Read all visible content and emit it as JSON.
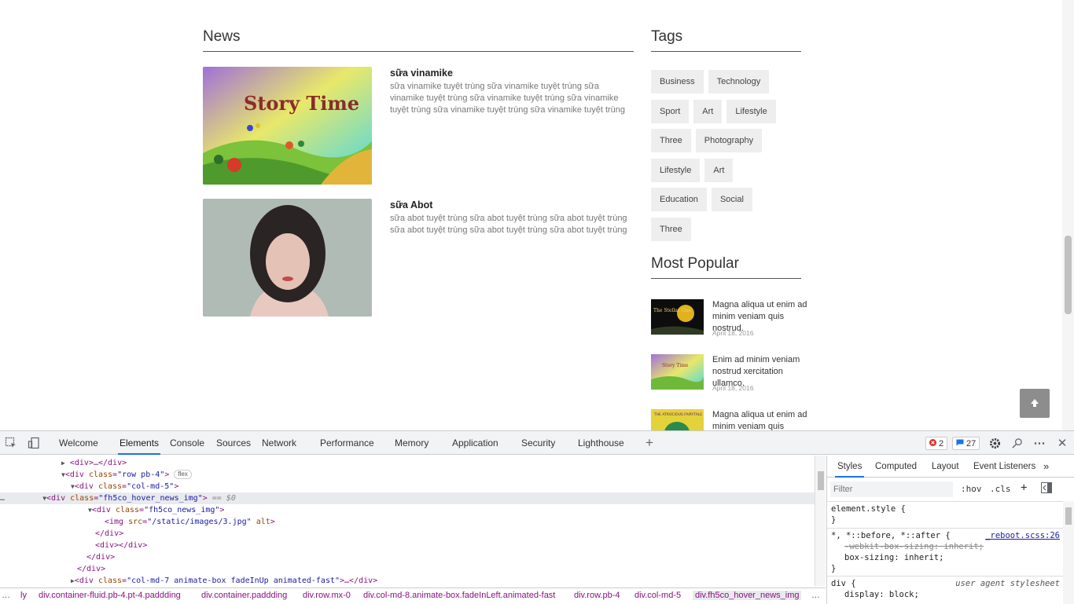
{
  "news": {
    "heading": "News",
    "items": [
      {
        "title": "sữa vinamike",
        "desc": "sữa vinamike tuyệt trùng sữa vinamike tuyệt trùng sữa vinamike tuyệt trùng sữa vinamike tuyệt trùng sữa vinamike tuyệt trùng sữa vinamike tuyệt trùng sữa vinamike tuyệt trùng",
        "image_text": "Story Time"
      },
      {
        "title": "sữa Abot",
        "desc": "sữa abot tuyệt trùng sữa abot tuyệt trùng sữa abot tuyệt trùng sữa abot tuyệt trùng sữa abot tuyệt trùng sữa abot tuyệt trùng"
      }
    ]
  },
  "tags": {
    "heading": "Tags",
    "items": [
      "Business",
      "Technology",
      "Sport",
      "Art",
      "Lifestyle",
      "Three",
      "Photography",
      "Lifestyle",
      "Art",
      "Education",
      "Social",
      "Three"
    ]
  },
  "popular": {
    "heading": "Most Popular",
    "items": [
      {
        "title": "Magna aliqua ut enim ad minim veniam quis nostrud.",
        "date": "April 18, 2016",
        "image_text": "The Stellar One"
      },
      {
        "title": "Enim ad minim veniam nostrud xercitation ullamco.",
        "date": "April 18, 2016",
        "image_text": "Story Time"
      },
      {
        "title": "Magna aliqua ut enim ad minim veniam quis",
        "date": "",
        "image_text": "THE ATROCIOUS FAIRYTALE"
      }
    ]
  },
  "back_to_top": {
    "icon": "arrow-up-icon"
  },
  "devtools": {
    "tabs": [
      "Welcome",
      "Elements",
      "Console",
      "Sources",
      "Network",
      "Performance",
      "Memory",
      "Application",
      "Security",
      "Lighthouse"
    ],
    "active_tab": "Elements",
    "error_count": "2",
    "message_count": "27",
    "dom": {
      "l1": "<div>…</div>",
      "l2_tag": "<div ",
      "l2_attr": "class",
      "l2_val": "\"row pb-4\"",
      "l2_pill": "flex",
      "l3_attr": "class",
      "l3_val": "\"col-md-5\"",
      "l4_attr": "class",
      "l4_val": "\"fh5co_hover_news_img\"",
      "l4_sel": "== $0",
      "l5_attr": "class",
      "l5_val": "\"fh5co_news_img\"",
      "l6_attr": "src",
      "l6_val": "\"/static/images/3.jpg\"",
      "l6_alt": "alt",
      "l7": "</div>",
      "l8": "<div></div>",
      "l9": "</div>",
      "l10": "</div>",
      "l11_attr": "class",
      "l11_val": "\"col-md-7 animate-box fadeInUp animated-fast\"",
      "l11_end": ">…</div>"
    },
    "breadcrumbs": [
      "ly",
      "div.container-fluid.pb-4.pt-4.paddding",
      "div.container.paddding",
      "div.row.mx-0",
      "div.col-md-8.animate-box.fadeInLeft.animated-fast",
      "div.row.pb-4",
      "div.col-md-5",
      "div.fh5co_hover_news_img"
    ],
    "styles": {
      "tabs": [
        "Styles",
        "Computed",
        "Layout",
        "Event Listeners"
      ],
      "filter_placeholder": "Filter",
      "hov": ":hov",
      "cls": ".cls",
      "element_style": "element.style {",
      "close_brace": "}",
      "rule2_selector": "*, *::before, *::after {",
      "rule2_source": "_reboot.scss:26",
      "rule2_prop1": "-webkit-box-sizing: inherit;",
      "rule2_prop2": "box-sizing: inherit;",
      "rule3_selector": "div {",
      "rule3_source": "user agent stylesheet",
      "rule3_prop1": "display: block;"
    }
  }
}
